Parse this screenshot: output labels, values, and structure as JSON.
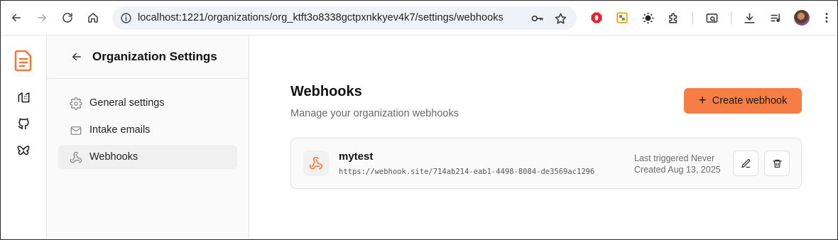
{
  "browser": {
    "url": "localhost:1221/organizations/org_ktft3o8338gctpxnkkyev4k7/settings/webhooks",
    "icons": [
      "back-icon",
      "forward-icon",
      "reload-icon",
      "home-icon",
      "site-info-icon",
      "password-key-icon",
      "bookmark-star-icon",
      "extension-icons",
      "downloads-icon",
      "media-icon",
      "profile-avatar",
      "menu-icon"
    ]
  },
  "sidebar_rail": {
    "items": [
      "app-logo-icon",
      "organization-icon",
      "github-icon",
      "butterfly-icon"
    ]
  },
  "settings_nav": {
    "title": "Organization Settings",
    "items": [
      {
        "label": "General settings",
        "icon": "gear-icon",
        "active": false
      },
      {
        "label": "Intake emails",
        "icon": "mail-icon",
        "active": false
      },
      {
        "label": "Webhooks",
        "icon": "webhook-icon",
        "active": true
      }
    ]
  },
  "main": {
    "title": "Webhooks",
    "subtitle": "Manage your organization webhooks",
    "create_button": "Create webhook",
    "webhooks": [
      {
        "name": "mytest",
        "url": "https://webhook.site/714ab214-eab1-4498-8084-de3569ac1296",
        "last_triggered": "Last triggered Never",
        "created": "Created Aug 13, 2025"
      }
    ]
  },
  "colors": {
    "accent": "#f77d47",
    "accent_icon": "#f0783c"
  }
}
